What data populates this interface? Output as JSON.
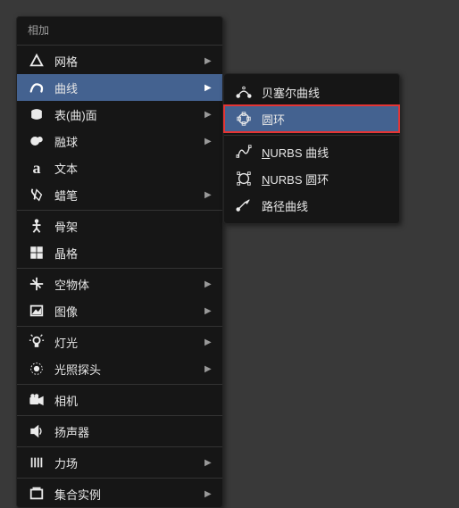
{
  "menu": {
    "title": "相加",
    "items": {
      "mesh": {
        "label": "网格",
        "has_submenu": true
      },
      "curve": {
        "label": "曲线",
        "has_submenu": true,
        "selected": true
      },
      "surface": {
        "label": "表(曲)面",
        "has_submenu": true
      },
      "metaball": {
        "label": "融球",
        "has_submenu": true
      },
      "text": {
        "label": "文本"
      },
      "gpencil": {
        "label": "蜡笔",
        "has_submenu": true
      },
      "armature": {
        "label": "骨架"
      },
      "lattice": {
        "label": "晶格"
      },
      "empty": {
        "label": "空物体",
        "has_submenu": true
      },
      "image": {
        "label": "图像",
        "has_submenu": true
      },
      "light": {
        "label": "灯光",
        "has_submenu": true
      },
      "lightprobe": {
        "label": "光照探头",
        "has_submenu": true
      },
      "camera": {
        "label": "相机"
      },
      "speaker": {
        "label": "扬声器"
      },
      "forcefield": {
        "label": "力场",
        "has_submenu": true
      },
      "collection": {
        "label": "集合实例",
        "has_submenu": true
      }
    }
  },
  "submenu": {
    "bezier": {
      "label_pre": "贝塞尔曲线"
    },
    "circle": {
      "label_pre": "圆环",
      "highlight": true
    },
    "nurbs_curve": {
      "underline": "N",
      "label_post": "URBS 曲线"
    },
    "nurbs_circle": {
      "underline": "N",
      "label_post": "URBS 圆环"
    },
    "path": {
      "label_pre": "路径曲线"
    }
  }
}
